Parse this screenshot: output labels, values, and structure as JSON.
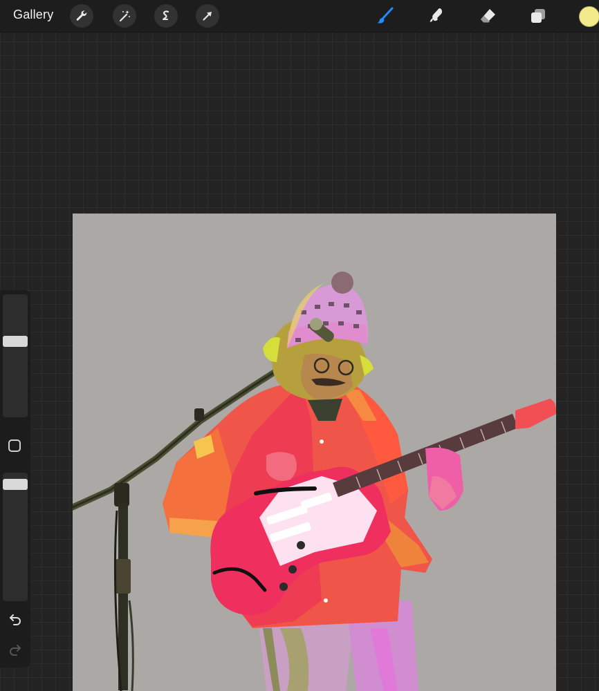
{
  "toolbar": {
    "gallery_label": "Gallery",
    "left_tools": [
      "wrench-icon",
      "magic-wand-icon",
      "selection-icon",
      "transform-arrow-icon"
    ],
    "right_tools": [
      "brush-icon",
      "smudge-icon",
      "eraser-icon",
      "layers-icon"
    ],
    "active_tool": "brush-icon",
    "accent_color": "#1f8cff",
    "current_color": "#f2ea8a"
  },
  "sidebar": {
    "brush_size_level": 0.37,
    "opacity_level": 0.95
  },
  "canvas": {
    "background_color": "#aba8a6"
  }
}
